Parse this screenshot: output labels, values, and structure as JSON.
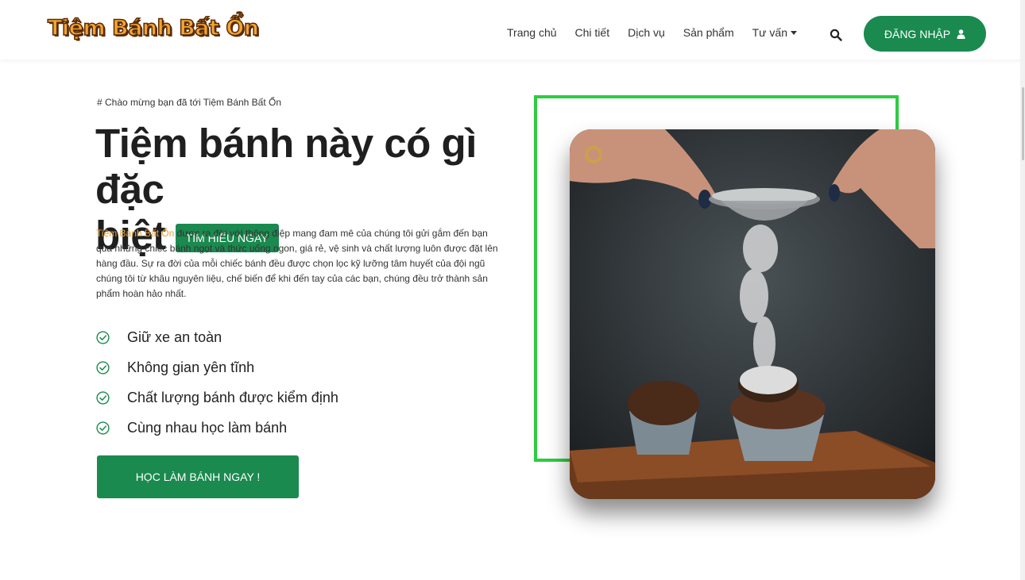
{
  "brand": {
    "logo_text": "Tiệm Bánh Bất Ổn"
  },
  "nav": {
    "items": [
      {
        "label": "Trang chủ",
        "dropdown": false
      },
      {
        "label": "Chi tiết",
        "dropdown": false
      },
      {
        "label": "Dịch vụ",
        "dropdown": false
      },
      {
        "label": "Sản phẩm",
        "dropdown": false
      },
      {
        "label": "Tư vấn",
        "dropdown": true
      }
    ],
    "search_icon": "search-icon",
    "login_label": "ĐĂNG NHẬP",
    "login_icon": "user-icon"
  },
  "hero": {
    "welcome": "# Chào mừng bạn đã tới Tiệm Bánh Bất Ổn",
    "title_line1": "Tiệm bánh này có gì đặc",
    "title_line2": "biệt",
    "learn_button": "TÌM HIỂU NGAY",
    "desc_brand": "Tiệm Bánh Bất Ổn",
    "desc_text": " được ra đời với thông điệp mang đam mê của chúng tôi gửi gắm đến bạn qua những chiếc bánh ngọt và thức uống ngon, giá rẻ, vệ sinh và chất lượng luôn được đặt lên hàng đầu. Sự ra đời của mỗi chiếc bánh đều được chọn lọc kỹ lưỡng tâm huyết của đội ngũ chúng tôi từ khâu nguyên liệu, chế biến để khi đến tay của các bạn, chúng đều trở thành sản phẩm hoàn hảo nhất.",
    "features": [
      "Giữ xe an toàn",
      "Không gian yên tĩnh",
      "Chất lượng bánh được kiểm định",
      "Cùng nhau học làm bánh"
    ],
    "cta_button": "HỌC LÀM BÁNH NGAY !"
  },
  "colors": {
    "primary_green": "#1a8a4f",
    "frame_green": "#2ecc40",
    "brand_orange": "#e8a23a"
  }
}
